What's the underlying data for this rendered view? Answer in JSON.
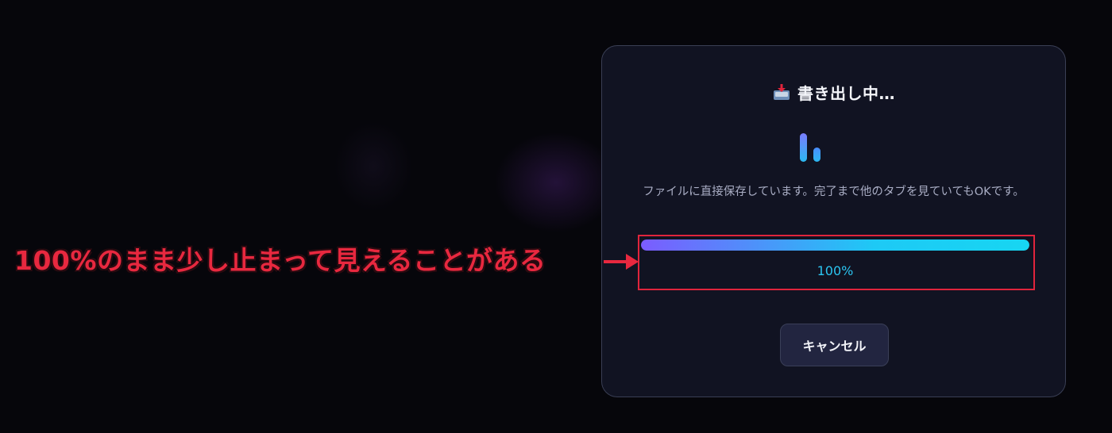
{
  "dialog": {
    "title": "書き出し中…",
    "title_icon": "outbox-tray-icon",
    "message": "ファイルに直接保存しています。完了まで他のタブを見ていてもOKです。",
    "progress": {
      "fraction": 1.0,
      "percent_label": "100%"
    },
    "cancel_label": "キャンセル"
  },
  "annotation": {
    "text": "100%のまま少し止まって見えることがある",
    "color": "#e8283f"
  },
  "colors": {
    "background": "#06060b",
    "dialog_bg": "#111322",
    "accent_cyan": "#2bc4f0",
    "accent_purple": "#7b5cff",
    "highlight_red": "#e0243c"
  }
}
